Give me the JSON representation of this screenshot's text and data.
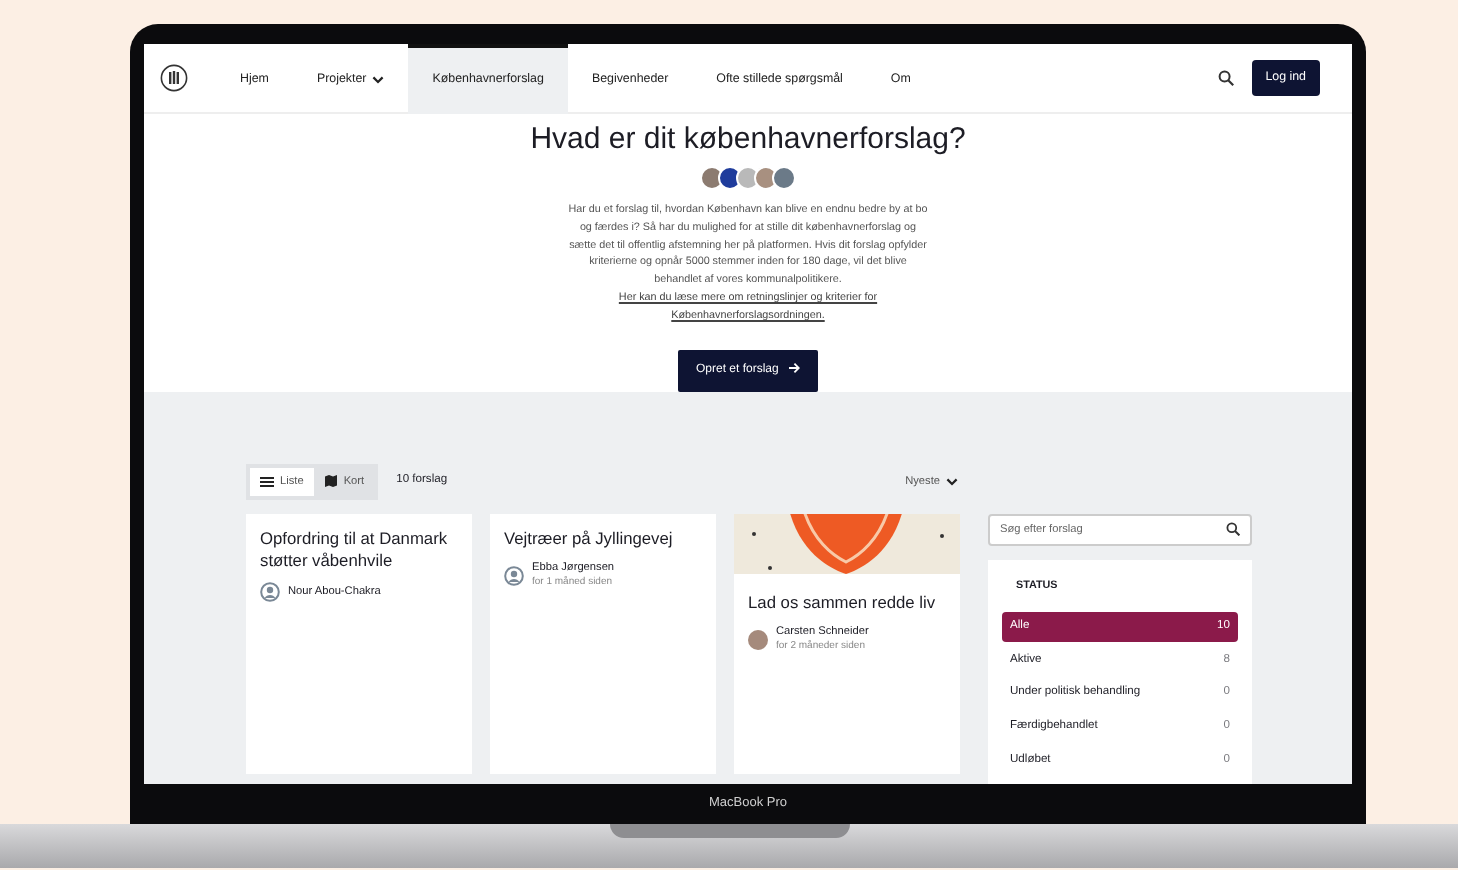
{
  "laptop": {
    "label": "MacBook Pro"
  },
  "nav": {
    "items": [
      {
        "label": "Hjem",
        "selected": false,
        "dropdown": false
      },
      {
        "label": "Projekter",
        "selected": false,
        "dropdown": true
      },
      {
        "label": "Københavnerforslag",
        "selected": true,
        "dropdown": false
      },
      {
        "label": "Begivenheder",
        "selected": false,
        "dropdown": false
      },
      {
        "label": "Ofte stillede spørgsmål",
        "selected": false,
        "dropdown": false
      },
      {
        "label": "Om",
        "selected": false,
        "dropdown": false
      }
    ],
    "login": "Log ind"
  },
  "hero": {
    "title": "Hvad er dit københavnerforslag?",
    "intro": "Har du et forslag til, hvordan København kan blive en endnu bedre by at bo og færdes i? Så har du mulighed for at stille dit københavnerforslag og sætte det til offentlig afstemning her på platformen. Hvis dit forslag opfylder kriterierne og opnår 5000 stemmer inden for 180 dage, vil det blive behandlet af vores kommunalpolitikere.",
    "link": "Her kan du læse mere om retningslinjer og kriterier for Københavnerforslagsordningen.",
    "button": "Opret et forslag"
  },
  "toolbar": {
    "views": [
      {
        "label": "Liste",
        "kind": "list",
        "selected": true
      },
      {
        "label": "Kort",
        "kind": "map",
        "selected": false
      }
    ],
    "count": "10 forslag",
    "sort": "Nyeste"
  },
  "cards": [
    {
      "kind": "text",
      "title": "Opfordring til at Danmark støtter våbenhvile",
      "author": "Nour Abou-Chakra"
    },
    {
      "kind": "text",
      "title": "Vejtræer på Jyllingevej",
      "author": "Ebba Jørgensen",
      "time": "for 1 måned siden"
    },
    {
      "kind": "picture",
      "title": "Lad os sammen redde liv",
      "author": "Carsten Schneider",
      "time": "for 2 måneder siden"
    }
  ],
  "sidebar": {
    "search_placeholder": "Søg efter forslag",
    "heading": "STATUS",
    "statuses": [
      {
        "label": "Alle",
        "count": "10",
        "selected": true
      },
      {
        "label": "Aktive",
        "count": "8",
        "selected": false
      },
      {
        "label": "Under politisk behandling",
        "count": "0",
        "selected": false
      },
      {
        "label": "Færdigbehandlet",
        "count": "0",
        "selected": false
      },
      {
        "label": "Udløbet",
        "count": "0",
        "selected": false
      }
    ]
  }
}
